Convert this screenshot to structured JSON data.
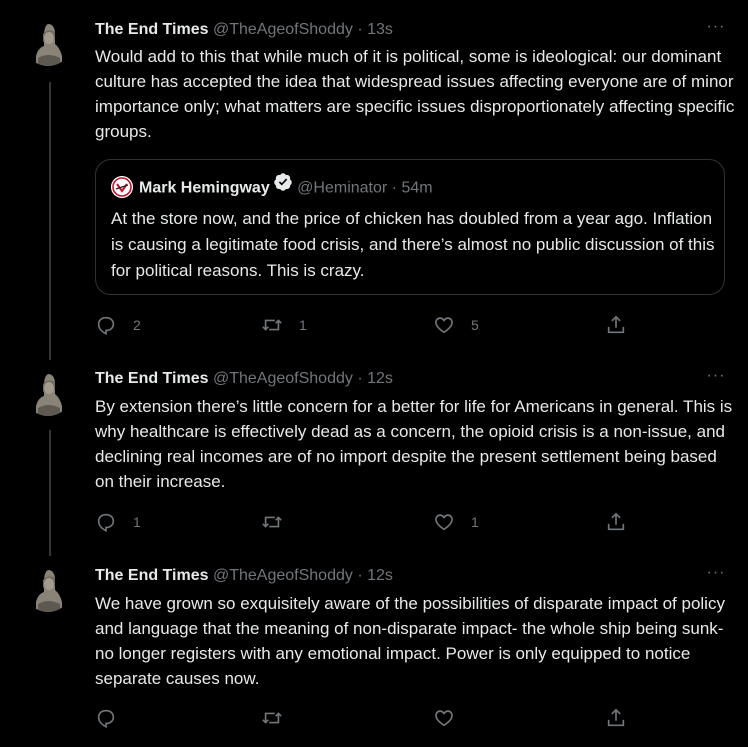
{
  "tweets": [
    {
      "name": "The End Times",
      "handle": "@TheAgeofShoddy",
      "dot": "·",
      "time": "13s",
      "more": "···",
      "text": "Would add to this that while much of it is political, some is ideological: our dominant culture has accepted the idea that widespread issues affecting everyone are of minor importance only; what matters are specific issues disproportionately affecting specific groups.",
      "quote": {
        "name": "Mark Hemingway",
        "handle": "@Heminator",
        "dot": "·",
        "time": "54m",
        "text": "At the store now, and the price of chicken has doubled from a year ago. Inflation is causing a legitimate food crisis, and there’s almost no public discussion of this for political reasons. This is crazy."
      },
      "replies": "2",
      "retweets": "1",
      "likes": "5"
    },
    {
      "name": "The End Times",
      "handle": "@TheAgeofShoddy",
      "dot": "·",
      "time": "12s",
      "more": "···",
      "text": "By extension there’s little concern for a better for life for Americans in general. This is why healthcare is effectively dead as a concern, the opioid crisis is a non-issue, and declining real incomes are of no import despite the present settlement being based on their increase.",
      "replies": "1",
      "retweets": "",
      "likes": "1"
    },
    {
      "name": "The End Times",
      "handle": "@TheAgeofShoddy",
      "dot": "·",
      "time": "12s",
      "more": "···",
      "text": "We have grown so exquisitely aware of the possibilities of disparate impact of policy and language that the meaning of non-disparate impact- the whole ship being sunk- no longer registers with any emotional impact. Power is only equipped to notice separate causes now.",
      "replies": "",
      "retweets": "",
      "likes": ""
    }
  ],
  "icons": {
    "avatar": "statue-avatar",
    "quote_avatar": "logo-avatar",
    "verified": "verified-badge-icon",
    "reply": "reply-icon",
    "retweet": "retweet-icon",
    "like": "like-icon",
    "share": "share-icon"
  },
  "colors": {
    "background": "#000000",
    "text": "#e7e9ea",
    "muted": "#71767b",
    "border": "#2f3336"
  }
}
